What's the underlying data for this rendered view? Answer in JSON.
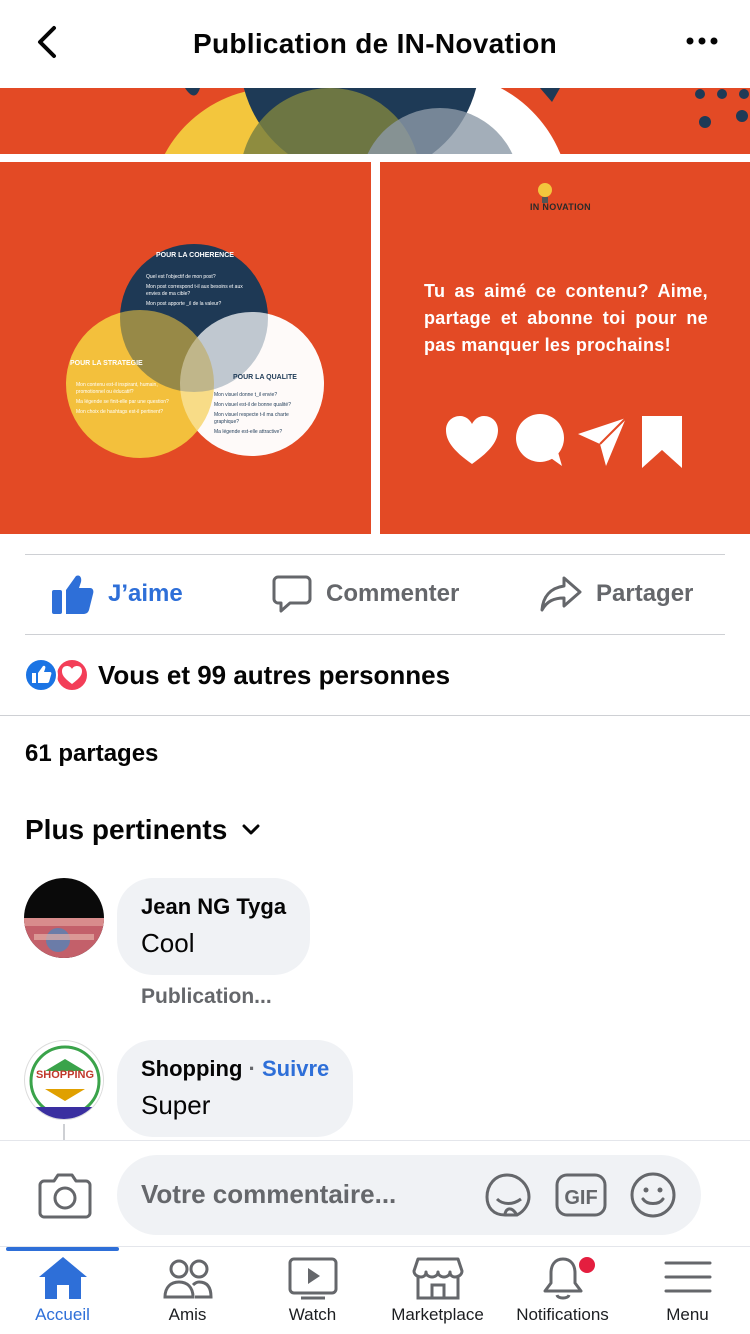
{
  "header": {
    "title": "Publication de IN-Novation"
  },
  "post": {
    "venn": {
      "coherence_title": "POUR LA COHERENCE",
      "coherence_items": [
        "Quel est l'objectif de mon post?",
        "Mon post correspond t-il aux besoins et aux envies de ma cible?",
        "Mon post apporte _il de la valeur?"
      ],
      "strategie_title": "POUR LA STRATEGIE",
      "strategie_items": [
        "Mon contenu est-il inspirant, humain, promotionnel ou éducatif?",
        "Ma légende se finit-elle par une question?",
        "Mon choix de hashtags est-il pertinent?"
      ],
      "qualite_title": "POUR LA QUALITE",
      "qualite_items": [
        "Mon visuel donne t_il envie?",
        "Mon visuel est-il de bonne qualité?",
        "Mon visuel respecte t-il ma charte graphique?",
        "Ma légende est-elle attractive?"
      ]
    },
    "brand": "IN NOVATION",
    "cta_text": "Tu as aimé ce contenu? Aime, partage et abonne toi pour ne pas manquer les prochains!"
  },
  "actions": {
    "like": "J’aime",
    "comment": "Commenter",
    "share": "Partager"
  },
  "reactions_text": "Vous et 99 autres personnes",
  "shares_text": "61 partages",
  "sort_label": "Plus pertinents",
  "comments": [
    {
      "name": "Jean NG Tyga",
      "text": "Cool",
      "meta": "Publication..."
    },
    {
      "name": "Shopping",
      "follow": "Suivre",
      "separator": " · ",
      "text": "Super",
      "avatar_label": "SHOPPING"
    }
  ],
  "composer": {
    "placeholder": "Votre commentaire..."
  },
  "nav": [
    {
      "label": "Accueil",
      "icon": "home-icon",
      "active": true
    },
    {
      "label": "Amis",
      "icon": "friends-icon"
    },
    {
      "label": "Watch",
      "icon": "watch-icon"
    },
    {
      "label": "Marketplace",
      "icon": "marketplace-icon"
    },
    {
      "label": "Notifications",
      "icon": "bell-icon"
    },
    {
      "label": "Menu",
      "icon": "menu-icon"
    }
  ],
  "colors": {
    "accent": "#2e6fd8",
    "post_bg": "#e34a25",
    "badge": "#e41e3f"
  }
}
